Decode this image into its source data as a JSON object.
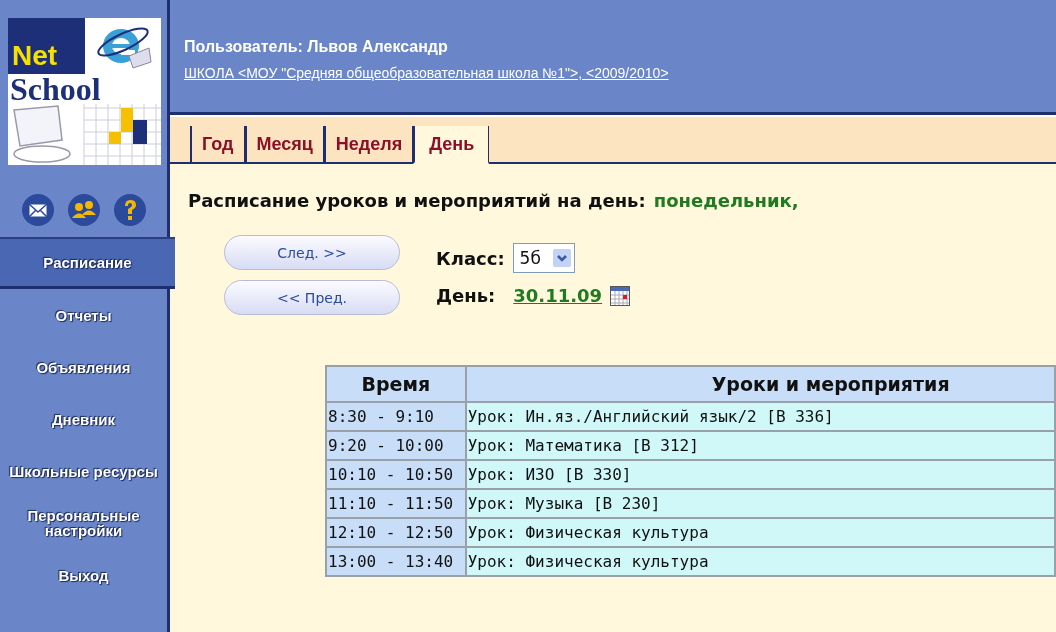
{
  "logo": {
    "line1": "Net",
    "line2": "School"
  },
  "header": {
    "user": "Пользователь: Львов Александр",
    "school_link": "ШКОЛА <МОУ \"Средняя общеобразовательная школа №1\">, <2009/2010>"
  },
  "sidebar": {
    "items": [
      {
        "label": "Расписание",
        "selected": true
      },
      {
        "label": "Отчеты",
        "selected": false
      },
      {
        "label": "Объявления",
        "selected": false
      },
      {
        "label": "Дневник",
        "selected": false
      },
      {
        "label": "Школьные ресурсы",
        "selected": false
      },
      {
        "label": "Персональные настройки",
        "selected": false
      },
      {
        "label": "Выход",
        "selected": false
      }
    ]
  },
  "tabs": [
    {
      "label": "Год",
      "selected": false
    },
    {
      "label": "Месяц",
      "selected": false
    },
    {
      "label": "Неделя",
      "selected": false
    },
    {
      "label": "День",
      "selected": true
    }
  ],
  "heading": {
    "label": "Расписание уроков и мероприятий на день:",
    "date": "понедельник,"
  },
  "buttons": [
    {
      "label": "След. >>"
    },
    {
      "label": "<< Пред."
    }
  ],
  "class_field": {
    "label": "Класс:",
    "value": "5б"
  },
  "day_field": {
    "label": "День:",
    "value": "30.11.09"
  },
  "table": {
    "columns": [
      "Время",
      "Уроки и мероприятия"
    ],
    "rows": [
      [
        "8:30 - 9:10",
        "Урок: Ин.яз./Английский язык/2 [В 336]"
      ],
      [
        "9:20 - 10:00",
        "Урок: Математика [В 312]"
      ],
      [
        "10:10 - 10:50",
        "Урок: ИЗО [В 330]"
      ],
      [
        "11:10 - 11:50",
        "Урок: Музыка [В 230]"
      ],
      [
        "12:10 - 12:50",
        "Урок: Физическая культура"
      ],
      [
        "13:00 - 13:40",
        "Урок: Физическая культура"
      ]
    ]
  }
}
